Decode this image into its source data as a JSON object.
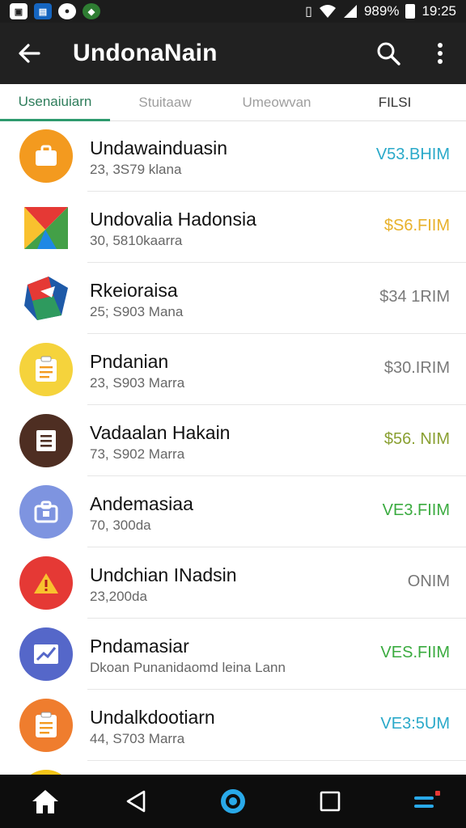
{
  "status_bar": {
    "notification_icons": [
      "image-icon",
      "calendar-icon",
      "camera-icon",
      "shield-icon"
    ],
    "battery": "989%",
    "time": "19:25"
  },
  "app_bar": {
    "title": "UndonaNain"
  },
  "tabs": [
    {
      "label": "Usenaiuiarn",
      "active": true
    },
    {
      "label": "Stuitaaw",
      "active": false
    },
    {
      "label": "Umeowvan",
      "active": false
    },
    {
      "label": "FILSI",
      "active": false
    }
  ],
  "list": [
    {
      "title": "Undawainduasin",
      "subtitle": "23, 3S79 klana",
      "price": "V53.BHIM",
      "price_color": "#29a9c9",
      "icon": "briefcase-icon",
      "icon_bg": "#f39a1f"
    },
    {
      "title": "Undovalia Hadonsia",
      "subtitle": "30, 5810kaarra",
      "price": "$S6.FIIM",
      "price_color": "#e8b12a",
      "icon": "maps-logo-icon",
      "icon_bg": "#ffffff"
    },
    {
      "title": "Rkeioraisa",
      "subtitle": "25; S903 Mana",
      "price": "$34 1RIM",
      "price_color": "#7a7a7a",
      "icon": "hexagon-logo-icon",
      "icon_bg": "#ffffff"
    },
    {
      "title": "Pndanian",
      "subtitle": "23, S903 Marra",
      "price": "$30.IRIM",
      "price_color": "#7a7a7a",
      "icon": "clipboard-icon",
      "icon_bg": "#f5d33c"
    },
    {
      "title": "Vadaalan Hakain",
      "subtitle": "73, S902 Marra",
      "price": "$56. NIM",
      "price_color": "#8aa032",
      "icon": "notepad-icon",
      "icon_bg": "#4e2e22"
    },
    {
      "title": "Andemasiaa",
      "subtitle": "70, 300da",
      "price": "VE3.FIIM",
      "price_color": "#3aab3f",
      "icon": "bag-icon",
      "icon_bg": "#7e94e0"
    },
    {
      "title": "Undchian INadsin",
      "subtitle": "23,200da",
      "price": "ONIM",
      "price_color": "#777777",
      "icon": "warning-icon",
      "icon_bg": "#e53935"
    },
    {
      "title": "Pndamasiar",
      "subtitle": "Dkoan Punanidaomd leina Lann",
      "price": "VES.FIIM",
      "price_color": "#3aab3f",
      "icon": "chart-icon",
      "icon_bg": "#5567c9"
    },
    {
      "title": "Undalkdootiarn",
      "subtitle": "44, S703 Marra",
      "price": "VE3:5UM",
      "price_color": "#29a9c9",
      "icon": "clipboard-icon",
      "icon_bg": "#ef7d2e"
    },
    {
      "title": "",
      "subtitle": "",
      "price": "",
      "price_color": "#777777",
      "icon": "app-icon",
      "icon_bg": "#f5c518"
    }
  ],
  "nav_bar": {
    "buttons": [
      "home-icon",
      "back-triangle-icon",
      "assistant-icon",
      "recents-icon",
      "menu-icon"
    ],
    "accent": "#29a9e9"
  }
}
